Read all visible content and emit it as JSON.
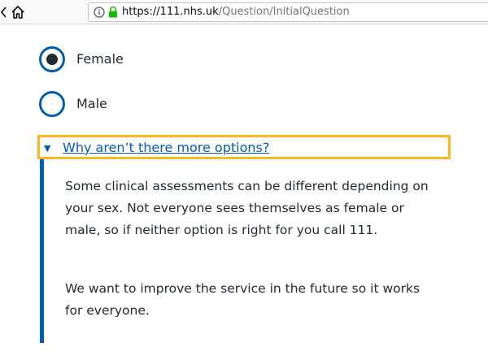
{
  "browser": {
    "url_host": "https://111.nhs.uk",
    "url_path": "/Question/InitialQuestion"
  },
  "question": {
    "options": [
      {
        "label": "Female",
        "selected": true
      },
      {
        "label": "Male",
        "selected": false
      }
    ]
  },
  "details": {
    "summary": "Why aren’t there more options?",
    "paragraphs": [
      "Some clinical assessments can be different depending on your sex. Not everyone sees themselves as female or male, so if neither option is right for you call 111.",
      "We want to improve the service in the future so it works for everyone."
    ]
  },
  "colors": {
    "link_blue": "#005eb8",
    "focus_yellow": "#ffb81c",
    "text": "#212b32"
  }
}
